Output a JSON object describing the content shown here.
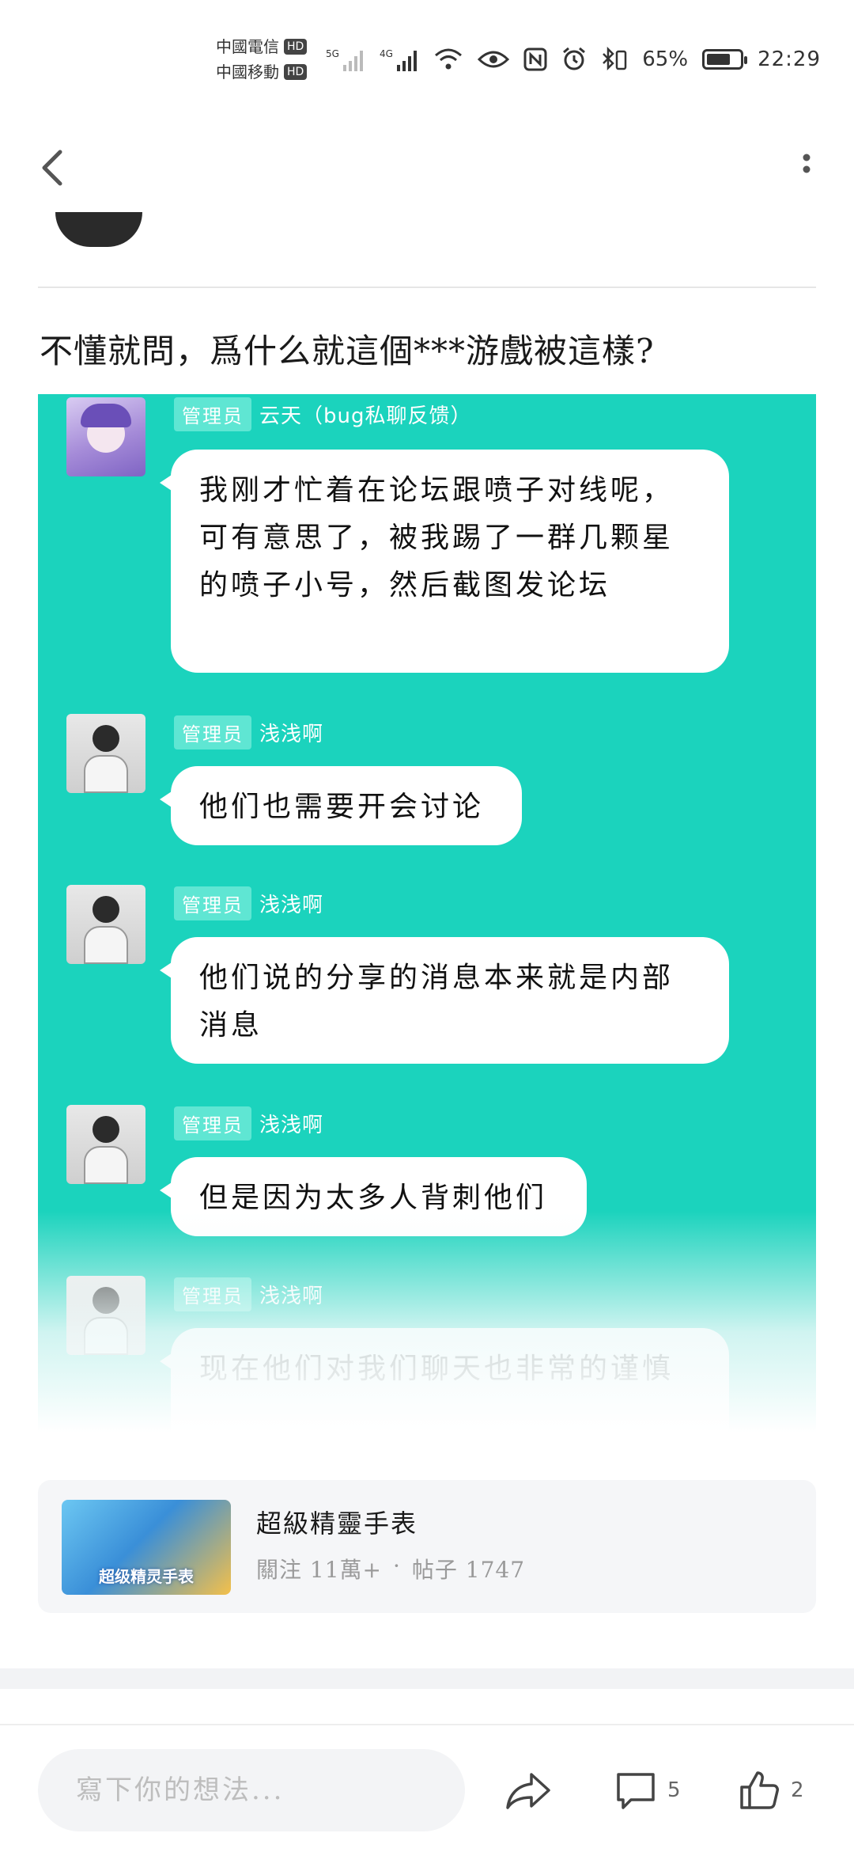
{
  "status_bar": {
    "carrier_1": "中國電信",
    "carrier_2": "中國移動",
    "hd_label": "HD",
    "network_1": "5G",
    "network_2": "4G",
    "battery": "65%",
    "time": "22:29"
  },
  "post": {
    "title": "不懂就問，爲什么就這個***游戲被這樣?"
  },
  "chat": {
    "messages": [
      {
        "role": "管理员",
        "sender": "云天（bug私聊反馈）",
        "text": "我刚才忙着在论坛跟喷子对线呢，可有意思了，被我踢了一群几颗星的喷子小号，然后截图发论坛"
      },
      {
        "role": "管理员",
        "sender": "浅浅啊",
        "text": "他们也需要开会讨论"
      },
      {
        "role": "管理员",
        "sender": "浅浅啊",
        "text": "他们说的分享的消息本来就是内部消息"
      },
      {
        "role": "管理员",
        "sender": "浅浅啊",
        "text": "但是因为太多人背刺他们"
      },
      {
        "role": "管理员",
        "sender": "浅浅啊",
        "text": "现在他们对我们聊天也非常的谨慎"
      }
    ]
  },
  "forum": {
    "name": "超級精靈手表",
    "follow_text": "關注 11萬+",
    "separator": "·",
    "posts_text": "帖子 1747",
    "thumb_text": "超级精灵手表"
  },
  "bottom_bar": {
    "comment_placeholder": "寫下你的想法...",
    "comments_count": "5",
    "likes_count": "2"
  },
  "colors": {
    "chat_background": "#1bd3bd",
    "badge": "#5fe6d3"
  }
}
